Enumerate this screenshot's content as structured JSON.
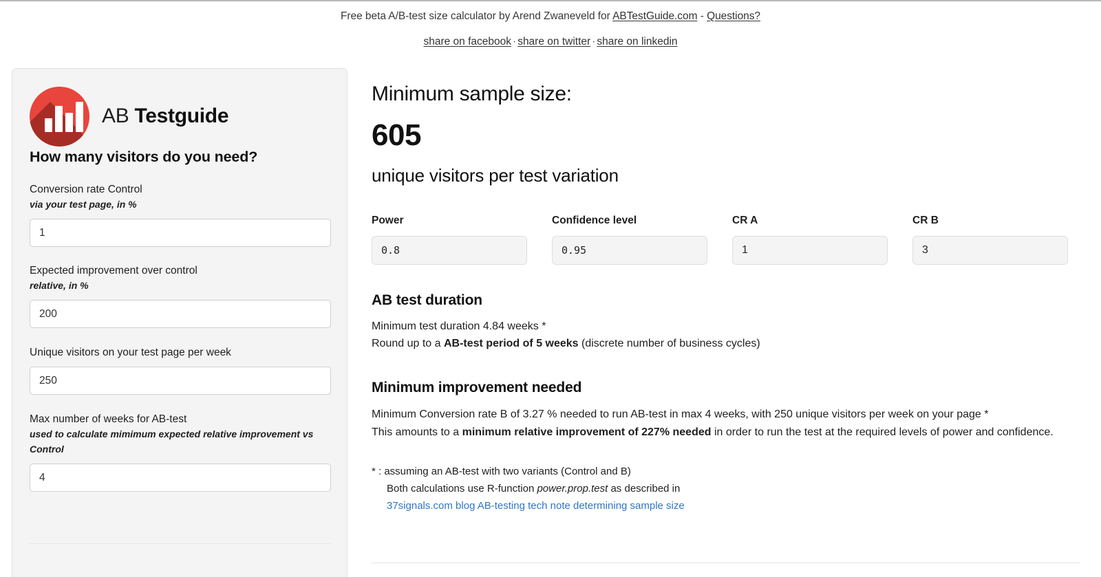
{
  "header": {
    "tagline_prefix": "Free beta A/B-test size calculator by Arend Zwaneveld for ",
    "site_link": "ABTestGuide.com",
    "tagline_sep": " - ",
    "questions_link": "Questions?",
    "share_facebook": "share on facebook",
    "share_twitter": "share on twitter",
    "share_linkedin": "share on linkedin",
    "separator": "·"
  },
  "sidebar": {
    "brand_light": "AB",
    "brand_bold": "Testguide",
    "heading": "How many visitors do you need?",
    "fields": [
      {
        "label": "Conversion rate Control",
        "sublabel": "via your test page, in %",
        "value": "1"
      },
      {
        "label": "Expected improvement over control",
        "sublabel": "relative, in %",
        "value": "200"
      },
      {
        "label": "Unique visitors on your test page per week",
        "sublabel": "",
        "value": "250"
      },
      {
        "label": "Max number of weeks for AB-test",
        "sublabel": "used to calculate mimimum expected relative improvement vs Control",
        "value": "4"
      }
    ]
  },
  "main": {
    "result_title": "Minimum sample size:",
    "result_number": "605",
    "result_subtitle": "unique visitors per test variation",
    "params": [
      {
        "label": "Power",
        "value": "0.8"
      },
      {
        "label": "Confidence level",
        "value": "0.95"
      },
      {
        "label": "CR A",
        "value": "1"
      },
      {
        "label": "CR B",
        "value": "3"
      }
    ],
    "duration": {
      "heading": "AB test duration",
      "line1": "Minimum test duration 4.84 weeks *",
      "line2_pre": "Round up to a ",
      "line2_bold": "AB-test period of 5 weeks",
      "line2_post": " (discrete number of business cycles)"
    },
    "improvement": {
      "heading": "Minimum improvement needed",
      "line1": "Minimum Conversion rate B of 3.27 % needed to run AB-test in max 4 weeks, with 250 unique visitors per week on your page *",
      "line2_pre": "This amounts to a ",
      "line2_bold": "minimum relative improvement of 227% needed",
      "line2_post": " in order to run the test at the required levels of power and confidence."
    },
    "footnotes": {
      "line1": "* : assuming an AB-test with two variants (Control and B)",
      "line2_pre": "Both calculations use R-function ",
      "line2_italic": "power.prop.test",
      "line2_post": " as described in",
      "line3_link": "37signals.com blog AB-testing tech note determining sample size"
    }
  }
}
